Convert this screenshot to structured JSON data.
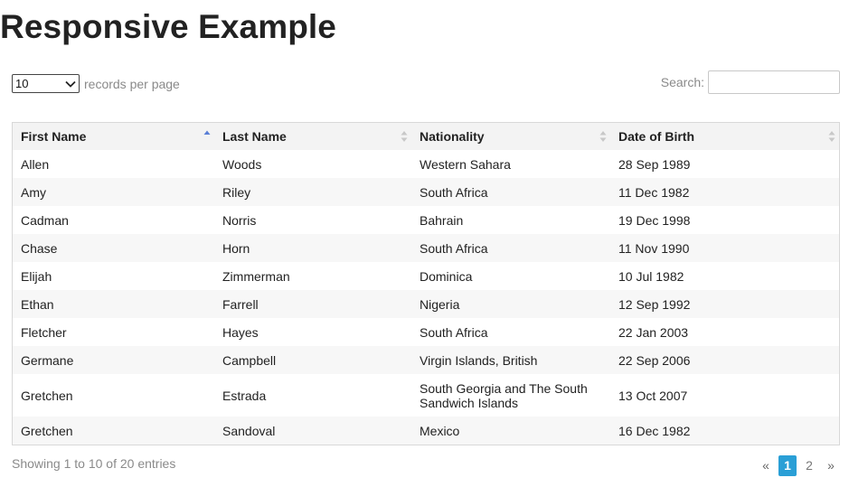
{
  "page": {
    "title": "Responsive Example"
  },
  "length": {
    "selected": "10",
    "suffix": "records per page"
  },
  "search": {
    "label": "Search:",
    "value": "",
    "placeholder": ""
  },
  "table": {
    "columns": [
      "First Name",
      "Last Name",
      "Nationality",
      "Date of Birth"
    ],
    "sorted_column": "First Name",
    "sort_direction": "ascending",
    "rows": [
      [
        "Allen",
        "Woods",
        "Western Sahara",
        "28 Sep 1989"
      ],
      [
        "Amy",
        "Riley",
        "South Africa",
        "11 Dec 1982"
      ],
      [
        "Cadman",
        "Norris",
        "Bahrain",
        "19 Dec 1998"
      ],
      [
        "Chase",
        "Horn",
        "South Africa",
        "11 Nov 1990"
      ],
      [
        "Elijah",
        "Zimmerman",
        "Dominica",
        "10 Jul 1982"
      ],
      [
        "Ethan",
        "Farrell",
        "Nigeria",
        "12 Sep 1992"
      ],
      [
        "Fletcher",
        "Hayes",
        "South Africa",
        "22 Jan 2003"
      ],
      [
        "Germane",
        "Campbell",
        "Virgin Islands, British",
        "22 Sep 2006"
      ],
      [
        "Gretchen",
        "Estrada",
        "South Georgia and The South Sandwich Islands",
        "13 Oct 2007"
      ],
      [
        "Gretchen",
        "Sandoval",
        "Mexico",
        "16 Dec 1982"
      ]
    ]
  },
  "info": {
    "text": "Showing 1 to 10 of 20 entries"
  },
  "pagination": {
    "prev": "«",
    "pages": [
      "1",
      "2"
    ],
    "current": "1",
    "next": "»"
  },
  "colors": {
    "accent": "#2a9fd6",
    "sort_active": "#5a7fd6",
    "sort_inactive": "#c8c8c8"
  }
}
